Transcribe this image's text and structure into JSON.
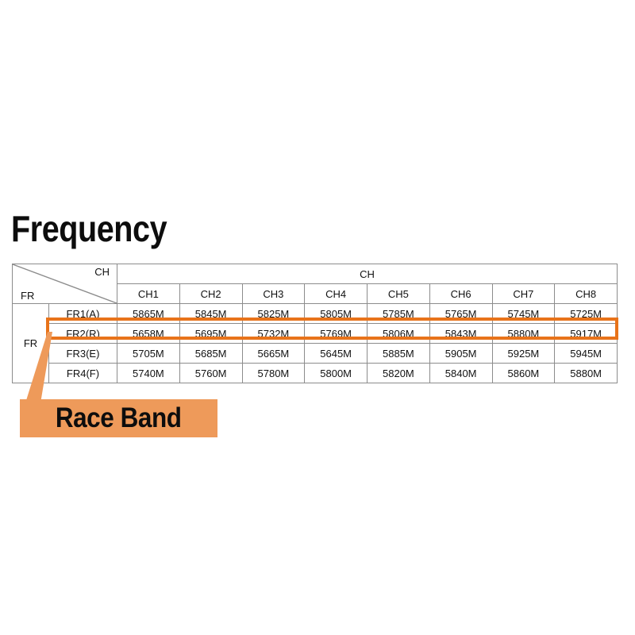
{
  "title": "Frequency",
  "table": {
    "corner": {
      "col_axis_label": "CH",
      "row_axis_label": "FR"
    },
    "group_header": "CH",
    "row_group_label": "FR",
    "channel_headers": [
      "CH1",
      "CH2",
      "CH3",
      "CH4",
      "CH5",
      "CH6",
      "CH7",
      "CH8"
    ],
    "rows": [
      {
        "band": "FR1(A)",
        "values": [
          "5865M",
          "5845M",
          "5825M",
          "5805M",
          "5785M",
          "5765M",
          "5745M",
          "5725M"
        ],
        "highlighted": false
      },
      {
        "band": "FR2(R)",
        "values": [
          "5658M",
          "5695M",
          "5732M",
          "5769M",
          "5806M",
          "5843M",
          "5880M",
          "5917M"
        ],
        "highlighted": true
      },
      {
        "band": "FR3(E)",
        "values": [
          "5705M",
          "5685M",
          "5665M",
          "5645M",
          "5885M",
          "5905M",
          "5925M",
          "5945M"
        ],
        "highlighted": false
      },
      {
        "band": "FR4(F)",
        "values": [
          "5740M",
          "5760M",
          "5780M",
          "5800M",
          "5820M",
          "5840M",
          "5860M",
          "5880M"
        ],
        "highlighted": false
      }
    ]
  },
  "callout": {
    "label": "Race Band",
    "target_row": "FR2(R)"
  },
  "colors": {
    "highlight_orange": "#e8731a",
    "callout_background": "#ee9a5a",
    "table_border": "#8c8c8c",
    "text": "#111111",
    "page_background": "#ffffff"
  }
}
